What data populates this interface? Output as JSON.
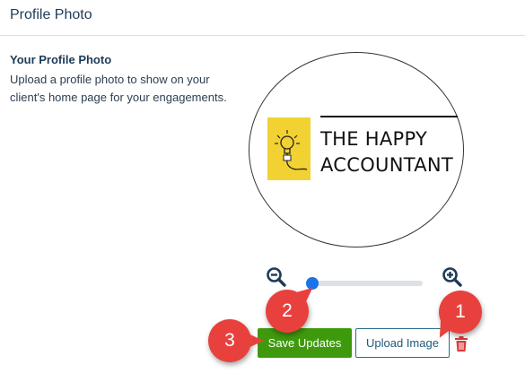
{
  "header": {
    "title": "Profile Photo"
  },
  "section": {
    "heading": "Your Profile Photo",
    "description": "Upload a profile photo to show on your client's home page for your engagements."
  },
  "photo": {
    "logo_line1": "THE HAPPY",
    "logo_line2": "ACCOUNTANT",
    "logo_colors": {
      "square": "#f2d233",
      "text": "#111111"
    }
  },
  "zoom": {
    "zoom_out_icon": "zoom-out-icon",
    "zoom_in_icon": "zoom-in-icon",
    "level": 0.05,
    "accent": "#1a73e8"
  },
  "actions": {
    "save_label": "Save Updates",
    "upload_label": "Upload Image",
    "delete_icon": "trash-icon",
    "save_color": "#3e9a0c"
  },
  "callouts": {
    "one": "1",
    "two": "2",
    "three": "3",
    "color": "#e8413d"
  }
}
